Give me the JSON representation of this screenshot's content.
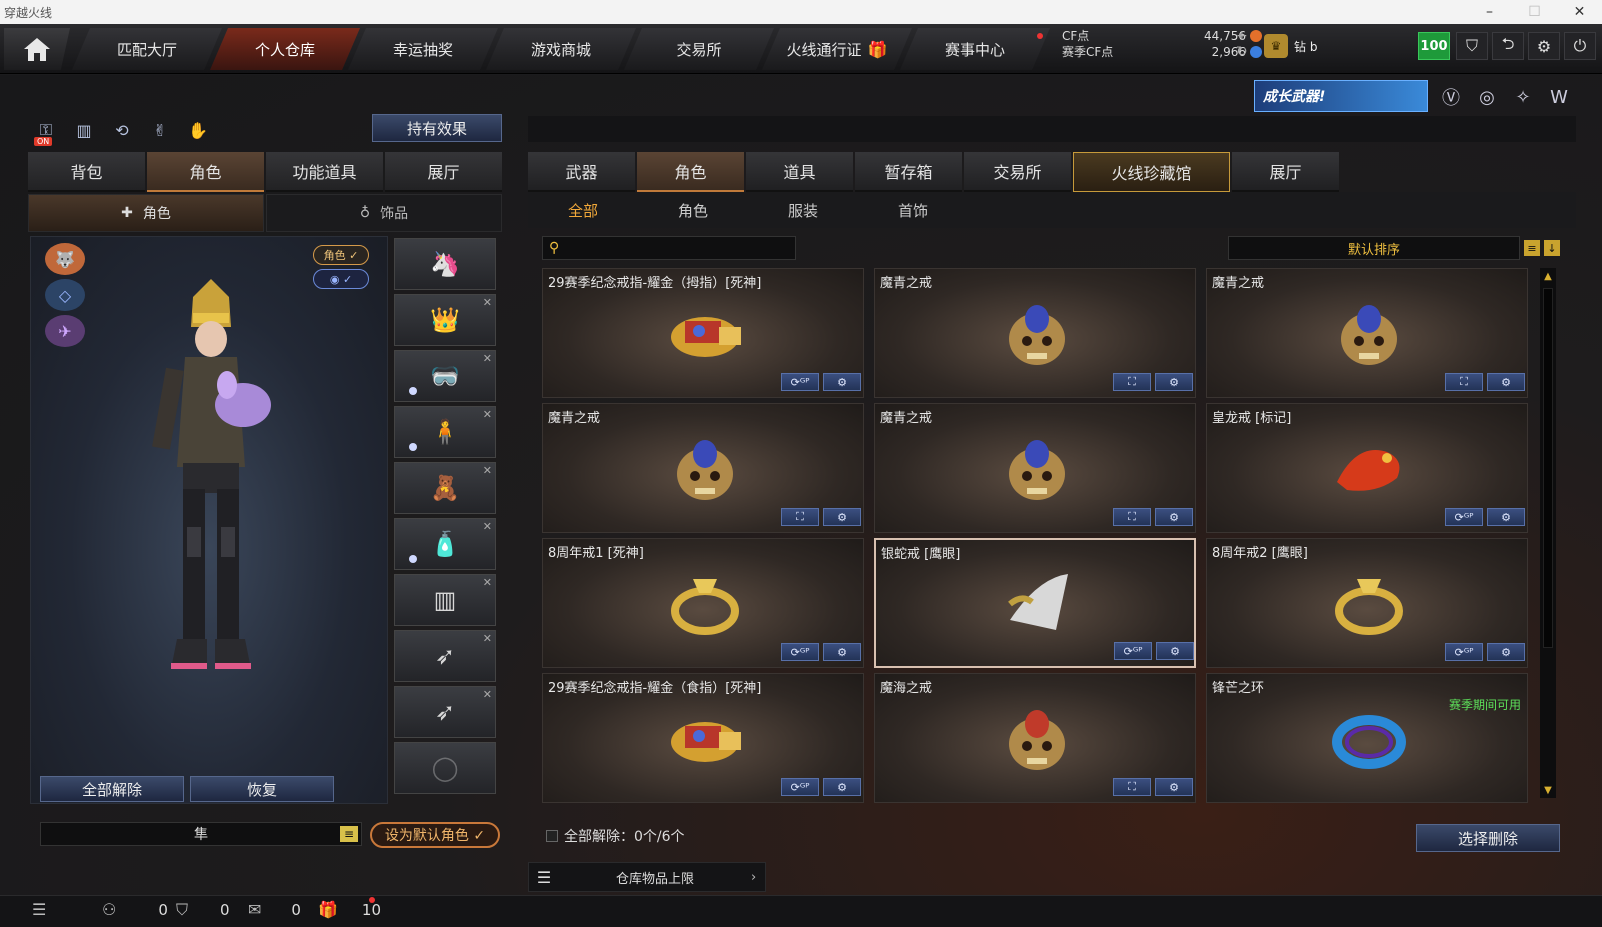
{
  "window": {
    "title": "穿越火线"
  },
  "nav": {
    "tabs": [
      {
        "label": "匹配大厅",
        "active": false
      },
      {
        "label": "个人仓库",
        "active": true
      },
      {
        "label": "幸运抽奖",
        "active": false
      },
      {
        "label": "游戏商城",
        "active": false
      },
      {
        "label": "交易所",
        "active": false
      },
      {
        "label": "火线通行证",
        "active": false
      },
      {
        "label": "赛事中心",
        "active": false
      }
    ]
  },
  "currency": {
    "cf_label": "CF点",
    "cf_value": "44,756",
    "season_label": "赛季CF点",
    "season_value": "2,966"
  },
  "rank": {
    "label": "钻 b"
  },
  "level": {
    "value": "100"
  },
  "banner": {
    "text": "成长武器!"
  },
  "left": {
    "hold_effect": "持有效果",
    "tabs": [
      "背包",
      "角色",
      "功能道具",
      "展厅"
    ],
    "active_tab": 1,
    "subtabs": [
      "角色",
      "饰品"
    ],
    "tag_character": "角色 ✓",
    "tag_visible": "✓",
    "btn_clear_all": "全部解除",
    "btn_restore": "恢复",
    "character_name": "隼",
    "set_default": "设为默认角色 ✓"
  },
  "right": {
    "tabs": [
      "武器",
      "角色",
      "道具",
      "暂存箱",
      "交易所",
      "火线珍藏馆",
      "展厅"
    ],
    "active_tab": 1,
    "subtabs": [
      "全部",
      "角色",
      "服装",
      "首饰"
    ],
    "active_subtab": 0,
    "search": {
      "placeholder": ""
    },
    "sort_label": "默认排序",
    "items": [
      {
        "name": "29赛季纪念戒指-耀金（拇指）[死神]",
        "kind": "gold-ring",
        "btn1": "GP",
        "selected": false,
        "season": ""
      },
      {
        "name": "魔青之戒",
        "kind": "skull-ring",
        "btn1": "map",
        "selected": false,
        "season": ""
      },
      {
        "name": "魔青之戒",
        "kind": "skull-ring",
        "btn1": "map",
        "selected": false,
        "season": ""
      },
      {
        "name": "魔青之戒",
        "kind": "skull-ring",
        "btn1": "map",
        "selected": false,
        "season": ""
      },
      {
        "name": "魔青之戒",
        "kind": "skull-ring",
        "btn1": "map",
        "selected": false,
        "season": ""
      },
      {
        "name": "皇龙戒 [标记]",
        "kind": "dragon-ring",
        "btn1": "GP",
        "selected": false,
        "season": ""
      },
      {
        "name": "8周年戒1 [死神]",
        "kind": "gold-band",
        "btn1": "GP",
        "selected": false,
        "season": ""
      },
      {
        "name": "银蛇戒 [鹰眼]",
        "kind": "snake-ring",
        "btn1": "GP",
        "selected": true,
        "season": ""
      },
      {
        "name": "8周年戒2 [鹰眼]",
        "kind": "gold-band",
        "btn1": "GP",
        "selected": false,
        "season": ""
      },
      {
        "name": "29赛季纪念戒指-耀金（食指）[死神]",
        "kind": "gold-ring",
        "btn1": "GP",
        "selected": false,
        "season": ""
      },
      {
        "name": "魔海之戒",
        "kind": "skull-ring-red",
        "btn1": "map",
        "selected": false,
        "season": ""
      },
      {
        "name": "锋芒之环",
        "kind": "blue-ring",
        "btn1": "",
        "selected": false,
        "season": "赛季期间可用"
      }
    ],
    "footer_count": "全部解除：0个/6个",
    "select_delete": "选择删除",
    "storage_limit": "仓库物品上限"
  },
  "status": {
    "count1": "0",
    "count2": "0",
    "count3": "0",
    "count4": "10"
  },
  "colors": {
    "accent": "#f2a93a",
    "season_green": "#5de05a",
    "nav_active": "#7a2a1b"
  }
}
